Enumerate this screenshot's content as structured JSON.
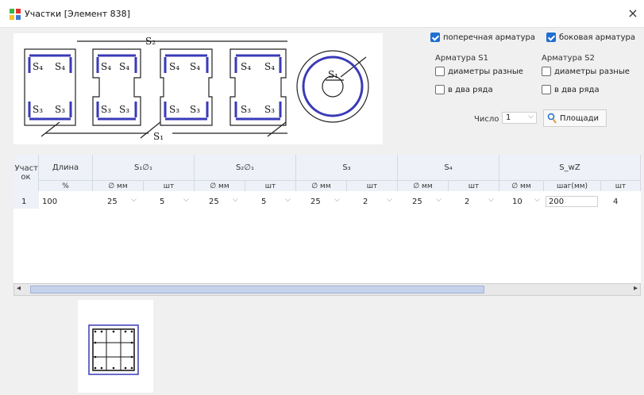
{
  "window": {
    "title": "Участки [Элемент 838]",
    "close": "×"
  },
  "scheme_labels": {
    "s1": "S₁",
    "s2": "S₂",
    "s3": "S₃",
    "s4": "S₄"
  },
  "options": {
    "transverse_label": "поперечная арматура",
    "transverse_checked": true,
    "lateral_label": "боковая арматура",
    "lateral_checked": true,
    "group_s1": "Арматура S1",
    "group_s2": "Арматура S2",
    "diam_diff_label": "диаметры разные",
    "two_rows_label": "в два ряда",
    "count_label": "Число",
    "count_value": "1",
    "areas_button": "Площади"
  },
  "table": {
    "header_row_col": "Участ ок",
    "col_length": "Длина",
    "col_length_unit": "%",
    "s1_header": "S₁∅₁",
    "s2_header": "S₂∅₁",
    "s3_header": "S₃",
    "s4_header": "S₄",
    "sw_header": "S_wZ",
    "sub_diam": "∅ мм",
    "sub_count": "шт",
    "sub_step": "шаг(мм)",
    "rows": [
      {
        "num": "1",
        "length": "100",
        "s1_d": "25",
        "s1_n": "5",
        "s2_d": "25",
        "s2_n": "5",
        "s3_d": "25",
        "s3_n": "2",
        "s4_d": "25",
        "s4_n": "2",
        "sw_d": "10",
        "sw_step": "200",
        "sw_n": "4"
      }
    ]
  },
  "scrollbar": {
    "left": "◂",
    "right": "▸"
  },
  "colors": {
    "accent": "#1f6fd1",
    "rebar": "#3a3ab8"
  }
}
